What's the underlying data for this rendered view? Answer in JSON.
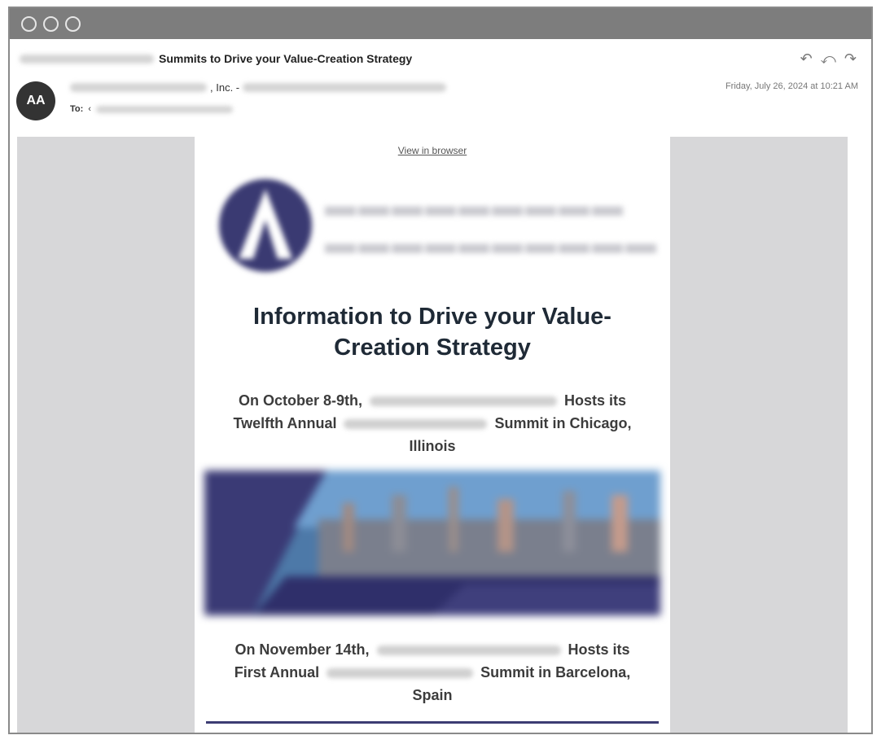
{
  "email": {
    "subject": "Summits to Drive your Value-Creation Strategy",
    "avatar_initials": "AA",
    "from_suffix": ", Inc. -",
    "to_label": "To:",
    "to_prefix": "‹",
    "date": "Friday, July 26, 2024 at 10:21 AM"
  },
  "actions": {
    "reply_icon": "reply-icon",
    "reply_all_icon": "reply-all-icon",
    "forward_icon": "forward-icon"
  },
  "content": {
    "view_in_browser": "View in browser",
    "headline": "Information to Drive your Value-Creation Strategy",
    "event1": {
      "prefix": "On October 8-9th,",
      "hosts": "Hosts its",
      "line2_prefix": "Twelfth Annual",
      "line2_suffix": "Summit in Chicago,",
      "line3": "Illinois"
    },
    "event2": {
      "prefix": "On November 14th,",
      "hosts": "Hosts its",
      "line2_prefix": "First Annual",
      "line2_suffix": "Summit in Barcelona,",
      "line3": "Spain"
    }
  },
  "colors": {
    "titlebar": "#7d7d7d",
    "brand_navy": "#3a3a72",
    "headline": "#1f2a36",
    "canvas_gray": "#d7d7d9"
  }
}
